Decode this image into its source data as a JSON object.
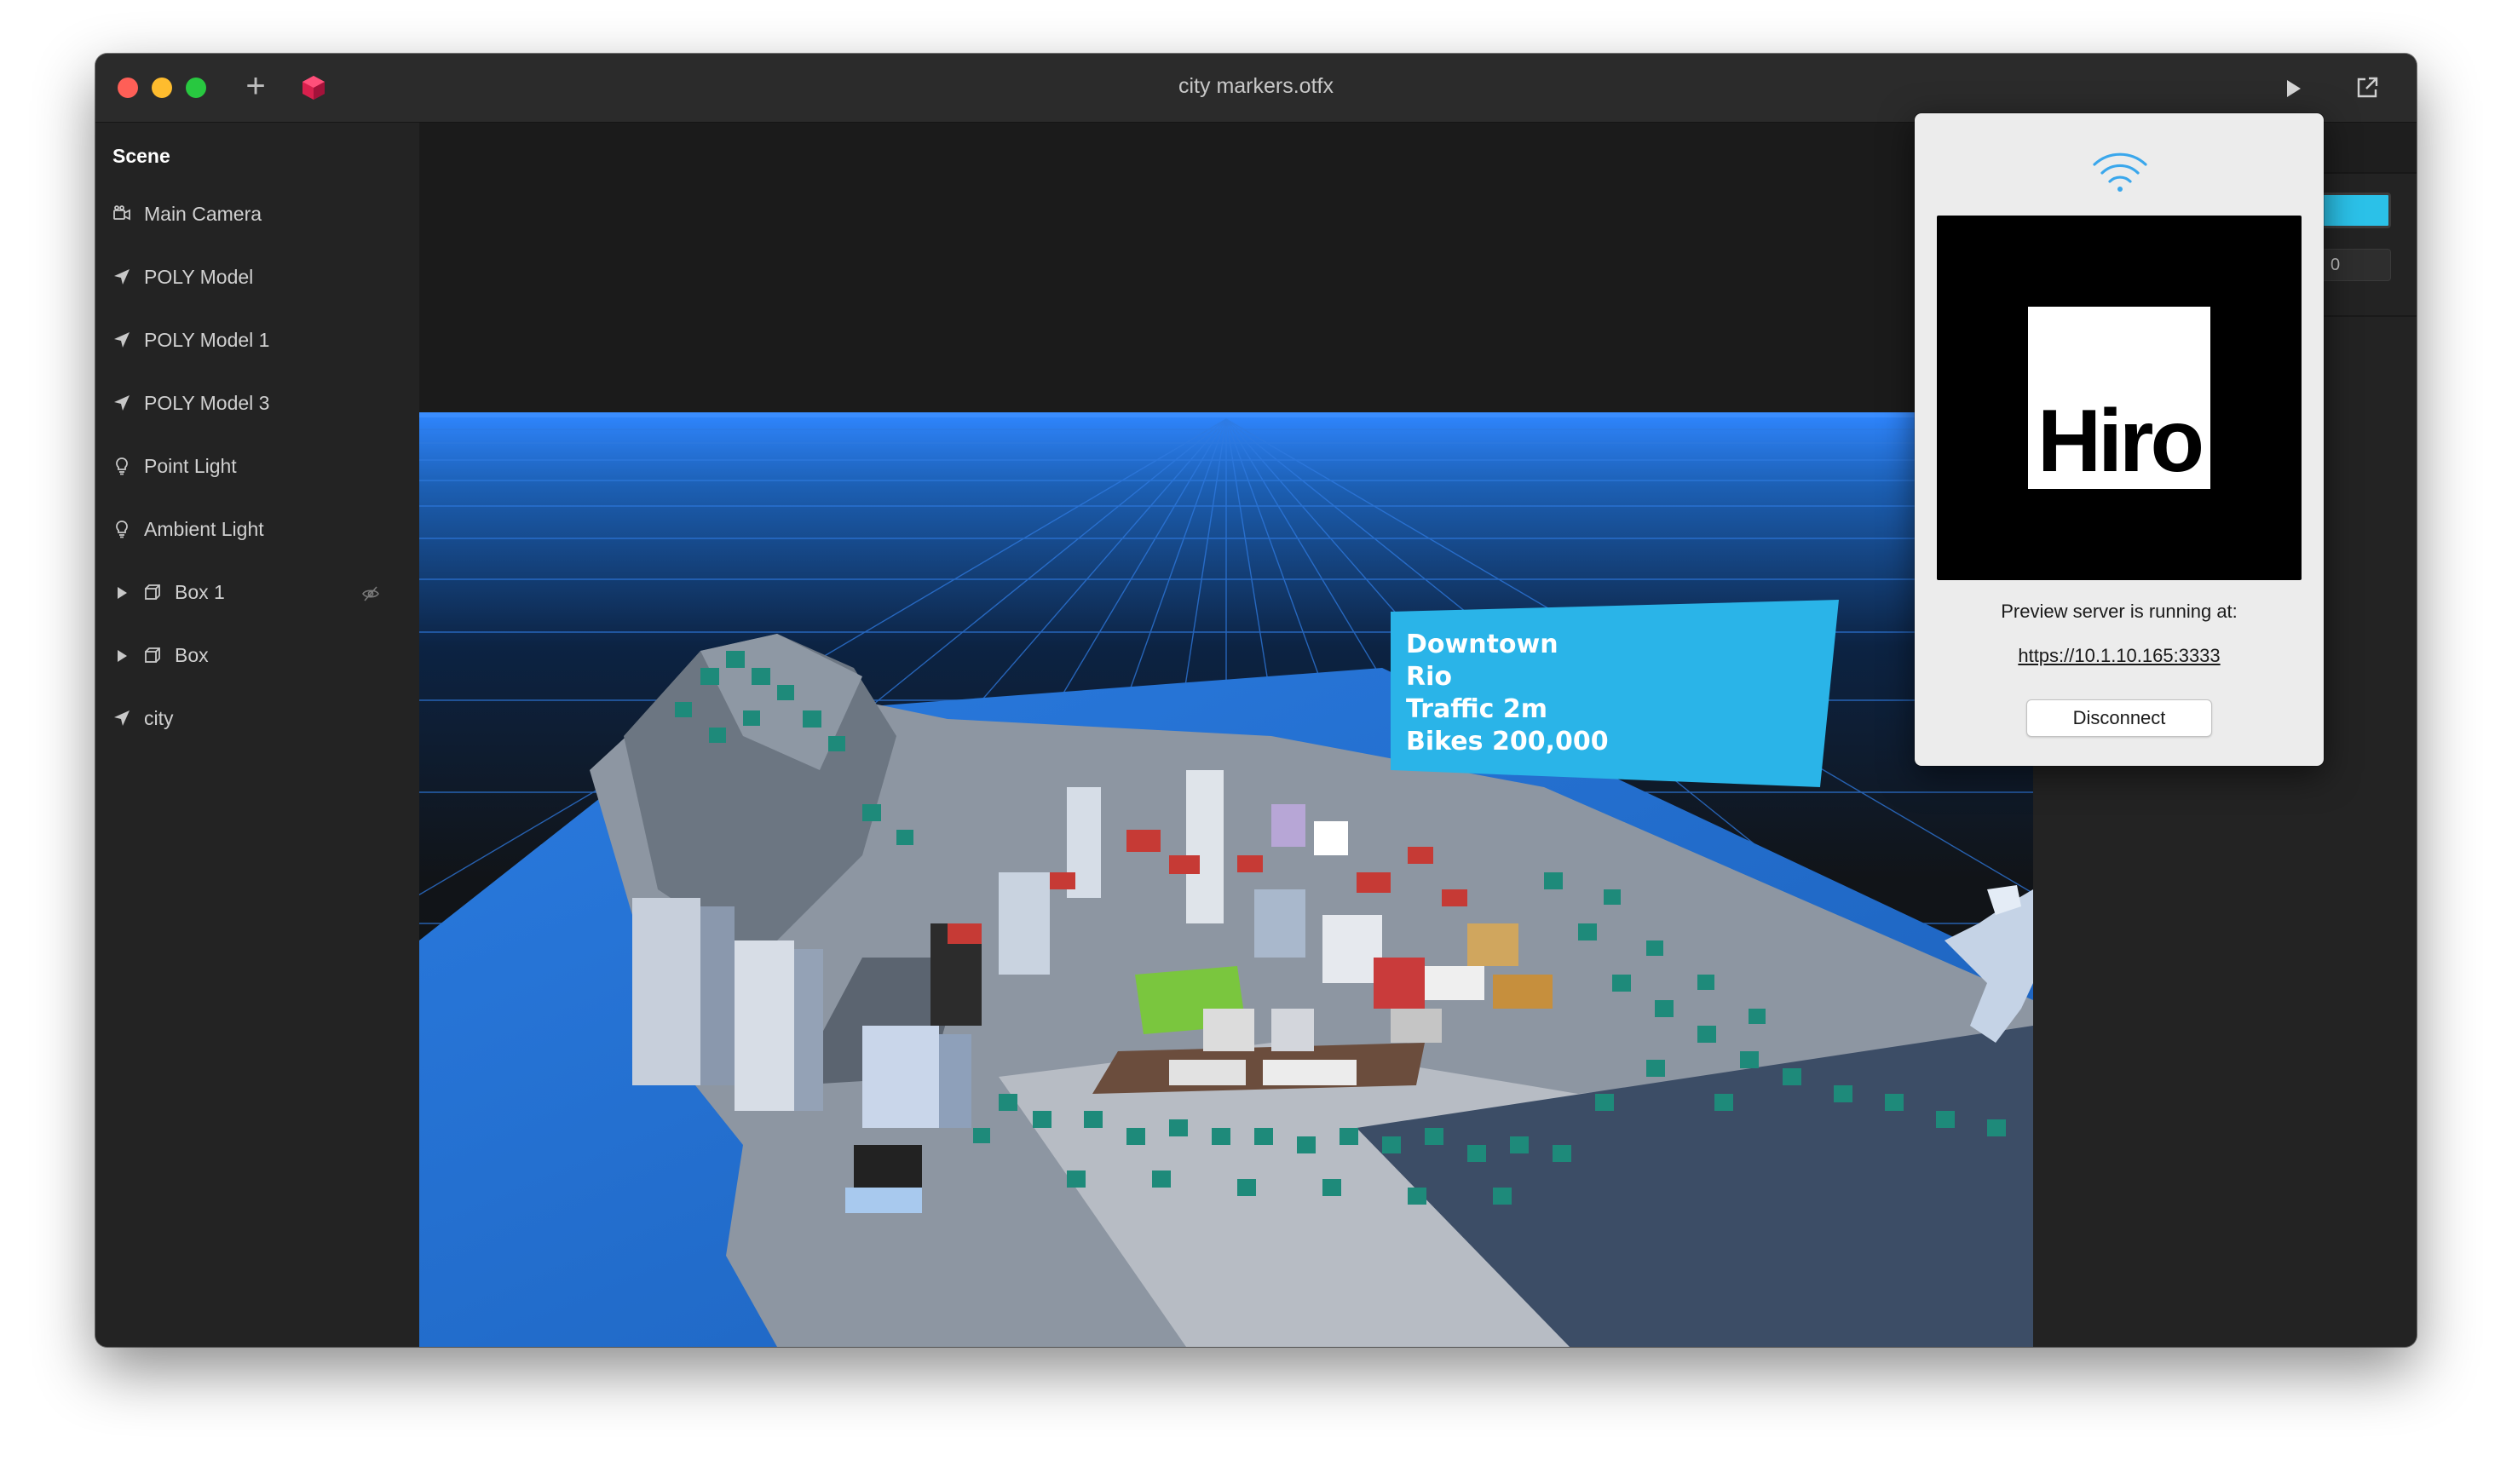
{
  "window": {
    "title": "city markers.otfx",
    "add_icon": "plus-icon",
    "app_icon": "cube-logo-icon",
    "play_icon": "play-icon",
    "share_icon": "open-external-icon"
  },
  "sidebar": {
    "header": "Scene",
    "items": [
      {
        "label": "Main Camera",
        "icon": "camera-icon"
      },
      {
        "label": "POLY Model",
        "icon": "model-icon"
      },
      {
        "label": "POLY Model 1",
        "icon": "model-icon"
      },
      {
        "label": "POLY Model 3",
        "icon": "model-icon"
      },
      {
        "label": "Point Light",
        "icon": "light-bulb-icon"
      },
      {
        "label": "Ambient Light",
        "icon": "light-bulb-icon"
      },
      {
        "label": "Box 1",
        "icon": "box-icon",
        "expandable": true,
        "hidden_toggle": "eye-slash-icon"
      },
      {
        "label": "Box",
        "icon": "box-icon",
        "expandable": true
      },
      {
        "label": "city",
        "icon": "model-icon"
      }
    ]
  },
  "viewport": {
    "label_lines": [
      "Downtown",
      "Rio",
      "Traffic 2m",
      "Bikes 200,000"
    ]
  },
  "inspector": {
    "color_value": "#2bc1e8",
    "number_value": "0"
  },
  "preview_popover": {
    "icon": "wifi-icon",
    "marker_text": "Hiro",
    "status": "Preview server is running at:",
    "url": "https://10.1.10.165:3333",
    "disconnect_label": "Disconnect"
  },
  "colors": {
    "accent": "#2bc1e8",
    "close": "#fe5f57",
    "minimize": "#febc2e",
    "maximize": "#28c840"
  }
}
